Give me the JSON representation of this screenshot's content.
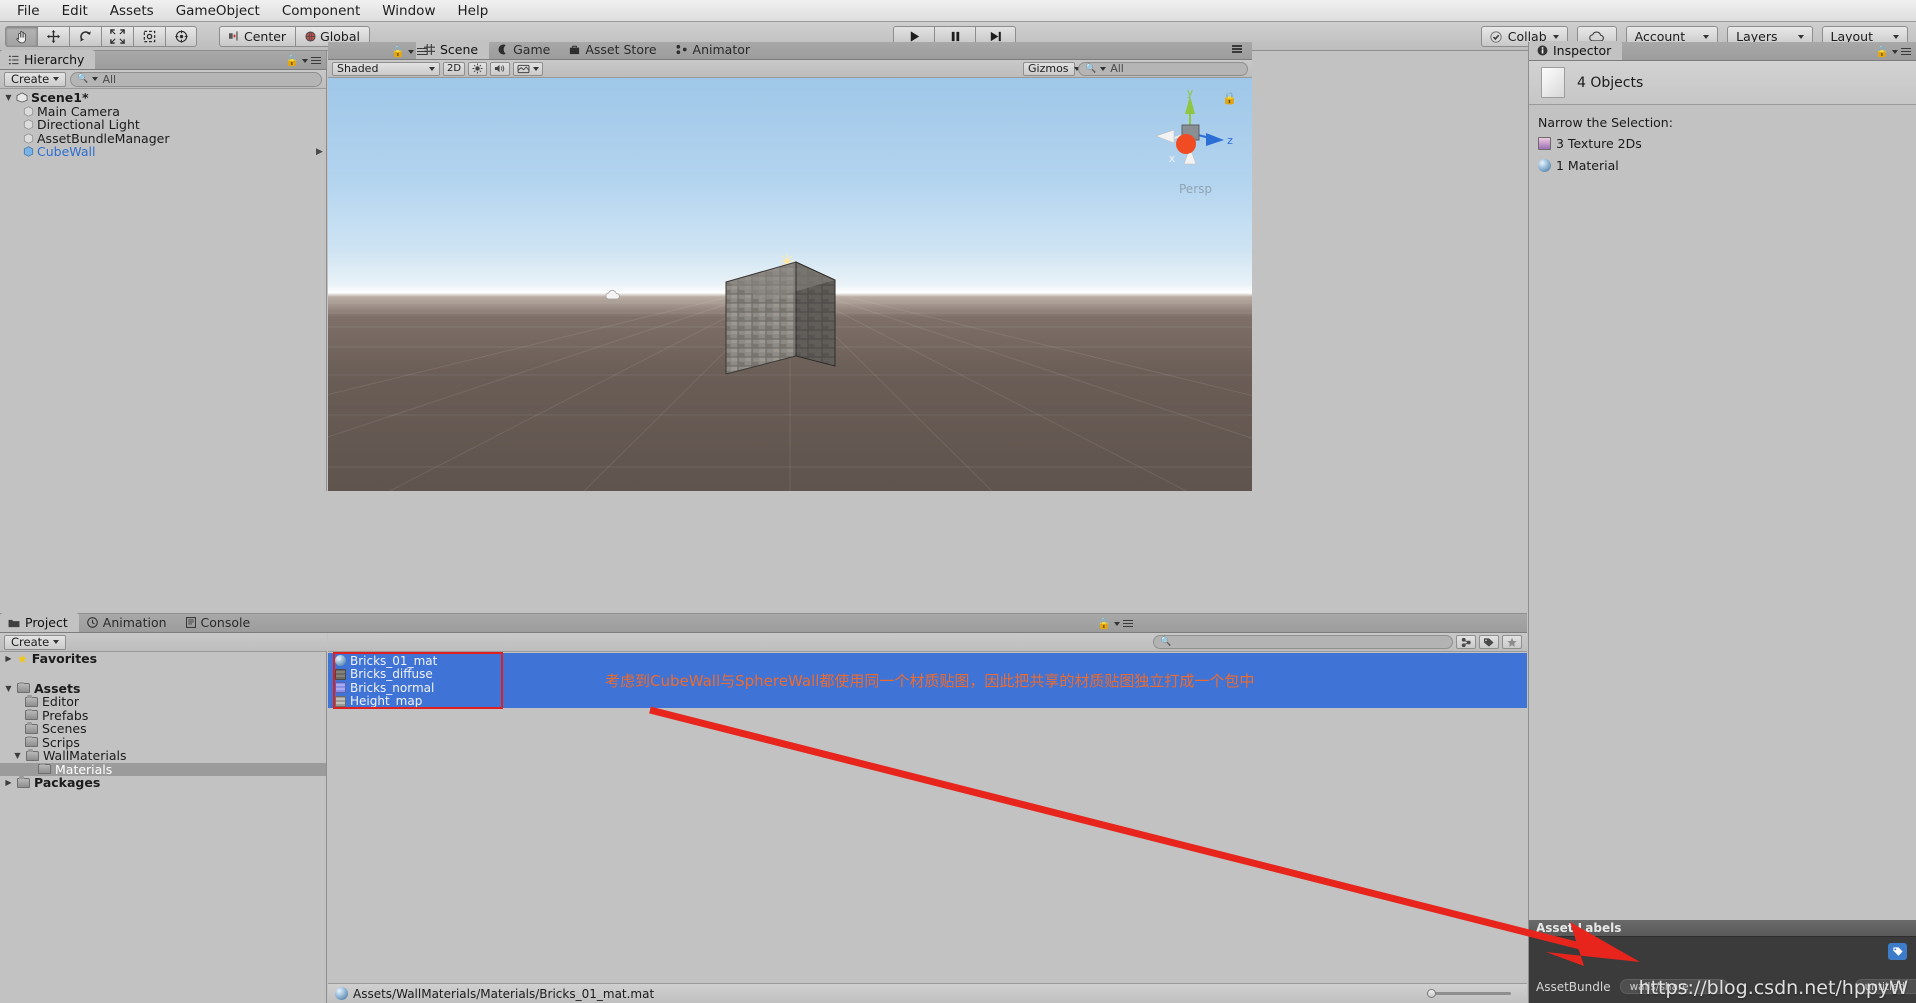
{
  "menubar": {
    "items": [
      "File",
      "Edit",
      "Assets",
      "GameObject",
      "Component",
      "Window",
      "Help"
    ]
  },
  "toolbar": {
    "tools": [
      "hand-tool",
      "move-tool",
      "rotate-tool",
      "scale-tool",
      "rect-tool",
      "transform-tool"
    ],
    "pivot_label": "Center",
    "space_label": "Global",
    "play_label": "play",
    "pause_label": "pause",
    "step_label": "step",
    "collab_label": "Collab",
    "cloud_label": "cloud",
    "account_label": "Account",
    "layers_label": "Layers",
    "layout_label": "Layout"
  },
  "hierarchy": {
    "tab_label": "Hierarchy",
    "create_label": "Create",
    "search_placeholder": "All",
    "scene_name": "Scene1*",
    "objects": [
      {
        "label": "Main Camera",
        "selected": false
      },
      {
        "label": "Directional Light",
        "selected": false
      },
      {
        "label": "AssetBundleManager",
        "selected": false
      },
      {
        "label": "CubeWall",
        "selected": true
      }
    ]
  },
  "scene": {
    "tabs": [
      {
        "label": "Scene",
        "icon": "grid-icon",
        "active": true
      },
      {
        "label": "Game",
        "icon": "gamepad-icon",
        "active": false
      },
      {
        "label": "Asset Store",
        "icon": "store-icon",
        "active": false
      },
      {
        "label": "Animator",
        "icon": "animator-icon",
        "active": false
      }
    ],
    "draw_mode": "Shaded",
    "mode_2d": "2D",
    "gizmos_label": "Gizmos",
    "gizmo_search_placeholder": "All",
    "axis_labels": {
      "x": "x",
      "y": "y",
      "z": "z"
    },
    "projection": "Persp"
  },
  "inspector": {
    "tab_label": "Inspector",
    "title": "4 Objects",
    "narrow_label": "Narrow the Selection:",
    "narrow_items": [
      {
        "label": "3 Texture 2Ds",
        "icon": "texture-icon"
      },
      {
        "label": "1 Material",
        "icon": "material-icon"
      }
    ]
  },
  "asset_labels": {
    "header": "Asset Labels",
    "bundle_label": "AssetBundle",
    "bundle_value": "walls/share",
    "variant_value": "untitled",
    "tag_icon": "tag-icon"
  },
  "project": {
    "tabs": [
      {
        "label": "Project",
        "icon": "folder-icon",
        "active": true
      },
      {
        "label": "Animation",
        "icon": "clock-icon",
        "active": false
      },
      {
        "label": "Console",
        "icon": "console-icon",
        "active": false
      }
    ],
    "create_label": "Create",
    "search_placeholder": "",
    "tree": [
      {
        "label": "Favorites",
        "depth": 0,
        "arrow": "right",
        "icon": "star-icon",
        "bold": true,
        "selected": false
      },
      {
        "label": "Assets",
        "depth": 0,
        "arrow": "down",
        "icon": "folder-icon",
        "bold": true,
        "selected": false
      },
      {
        "label": "Editor",
        "depth": 1,
        "arrow": "",
        "icon": "folder-icon",
        "bold": false,
        "selected": false
      },
      {
        "label": "Prefabs",
        "depth": 1,
        "arrow": "",
        "icon": "folder-icon",
        "bold": false,
        "selected": false
      },
      {
        "label": "Scenes",
        "depth": 1,
        "arrow": "",
        "icon": "folder-icon",
        "bold": false,
        "selected": false
      },
      {
        "label": "Scrips",
        "depth": 1,
        "arrow": "",
        "icon": "folder-icon",
        "bold": false,
        "selected": false
      },
      {
        "label": "WallMaterials",
        "depth": 1,
        "arrow": "down",
        "icon": "folder-icon",
        "bold": false,
        "selected": false
      },
      {
        "label": "Materials",
        "depth": 2,
        "arrow": "",
        "icon": "folder-icon",
        "bold": false,
        "selected": true
      },
      {
        "label": "Packages",
        "depth": 0,
        "arrow": "right",
        "icon": "folder-icon",
        "bold": true,
        "selected": false
      }
    ],
    "breadcrumb": [
      {
        "label": "Assets",
        "current": false
      },
      {
        "label": "WallMaterials",
        "current": false
      },
      {
        "label": "Materials",
        "current": true
      }
    ],
    "assets": [
      {
        "label": "Bricks_01_mat",
        "icon": "material-icon"
      },
      {
        "label": "Bricks_diffuse",
        "icon": "texture-dark-icon"
      },
      {
        "label": "Bricks_normal",
        "icon": "texture-normal-icon"
      },
      {
        "label": "Height_map",
        "icon": "texture-gray-icon"
      }
    ],
    "annotation": "考虑到CubeWall与SphereWall都使用同一个材质贴图，因此把共享的材质贴图独立打成一个包中",
    "annotation_color": "#ef6b2c",
    "selection_color": "#3f73d6",
    "highlight_box_color": "#e02020"
  },
  "statusbar": {
    "path": "Assets/WallMaterials/Materials/Bricks_01_mat.mat"
  },
  "watermark": {
    "text": "https://blog.csdn.net/hppyW"
  }
}
